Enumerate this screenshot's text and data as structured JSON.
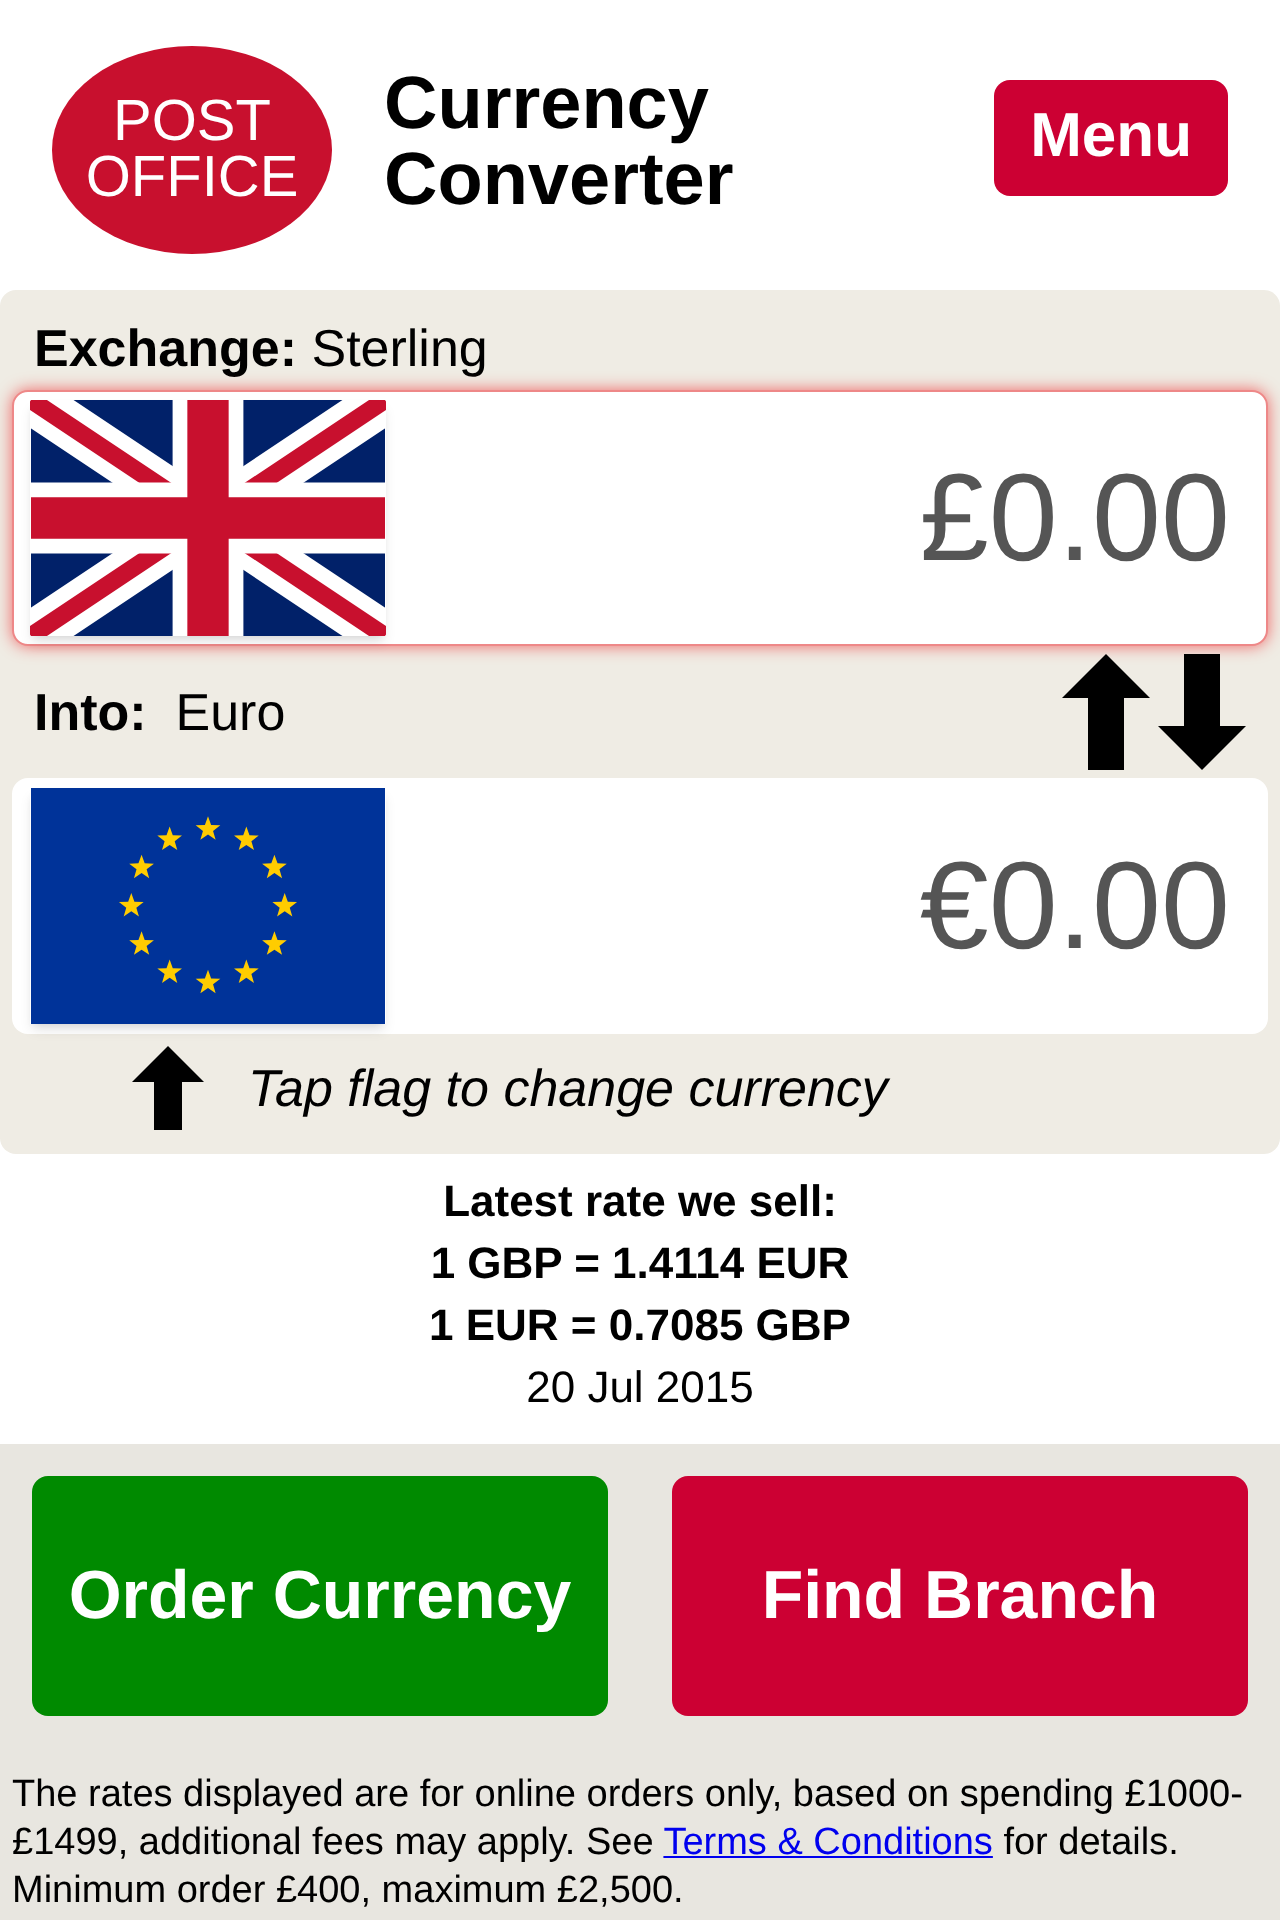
{
  "logo": {
    "line_1": "POST",
    "line_2": "OFFICE"
  },
  "title": {
    "line_1": "Currency",
    "line_2": "Converter"
  },
  "menu_button": "Menu",
  "converter": {
    "from": {
      "label": "**Exchange:** Sterling",
      "kind": "uk",
      "amount": "£0.00",
      "selected": true
    },
    "to": {
      "label": "**Into:**  Euro",
      "kind": "eu",
      "amount": "€0.00",
      "selected": false
    },
    "hint": "Tap flag to change currency"
  },
  "rates": {
    "heading": "Latest rate we sell:",
    "line_1": "1 GBP = 1.4114 EUR",
    "line_2": "1 EUR = 0.7085 GBP",
    "date": "20 Jul 2015"
  },
  "buttons": [
    {
      "label": "Order Currency",
      "color": "#008a00"
    },
    {
      "label": "Find Branch",
      "color": "#cc0033"
    }
  ],
  "footer": {
    "before": "The rates displayed are for online orders only, based on spending £1000-£1499, additional fees may apply. See ",
    "link": "Terms & Conditions",
    "after": " for details. Minimum order £400, maximum £2,500."
  }
}
